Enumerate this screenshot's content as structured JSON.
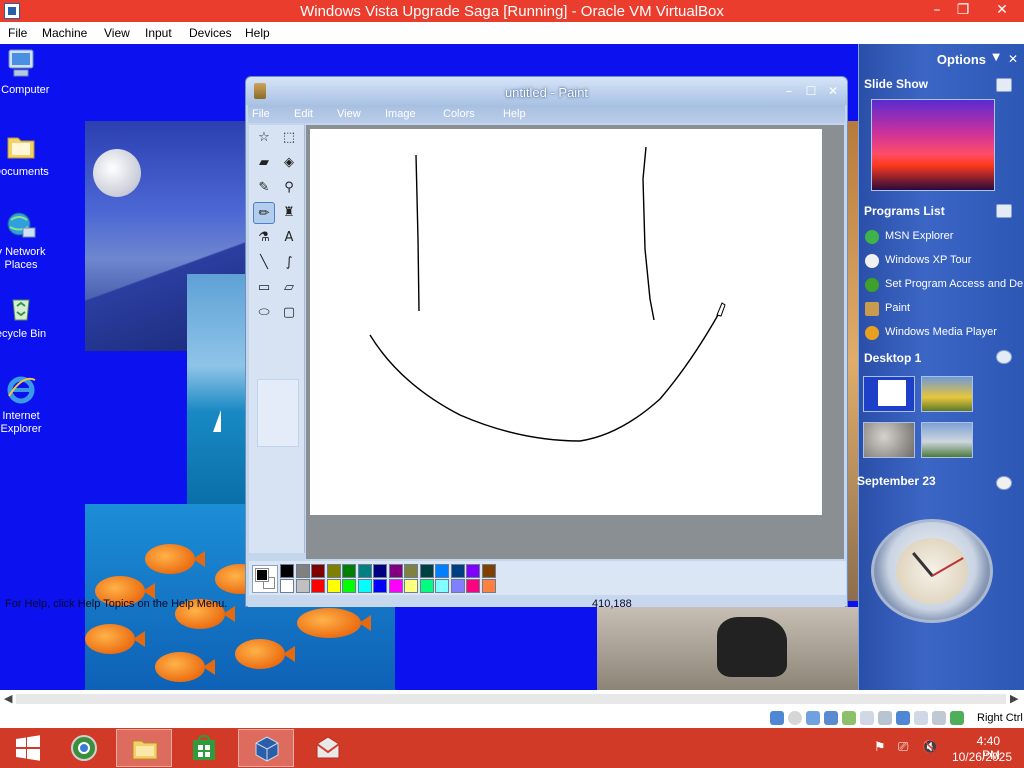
{
  "host": {
    "title": "Windows Vista Upgrade Saga [Running] - Oracle VM VirtualBox",
    "menu": [
      "File",
      "Machine",
      "View",
      "Input",
      "Devices",
      "Help"
    ],
    "controls": {
      "minimize": "–",
      "restore": "❐",
      "close": "✕"
    }
  },
  "desktop": {
    "icons": [
      {
        "label": "y Computer"
      },
      {
        "label": "Documents"
      },
      {
        "label": "y Network Places"
      },
      {
        "label": "ecycle Bin"
      },
      {
        "label": "Internet Explorer"
      }
    ]
  },
  "paint": {
    "title": "untitled - Paint",
    "controls": {
      "minimize": "–",
      "maximize": "☐",
      "close": "✕"
    },
    "menu": [
      "File",
      "Edit",
      "View",
      "Image",
      "Colors",
      "Help"
    ],
    "tools": [
      {
        "name": "free-select-icon",
        "glyph": "☆"
      },
      {
        "name": "rect-select-icon",
        "glyph": "⬚"
      },
      {
        "name": "eraser-icon",
        "glyph": "▰"
      },
      {
        "name": "fill-icon",
        "glyph": "◈"
      },
      {
        "name": "color-picker-icon",
        "glyph": "✎"
      },
      {
        "name": "magnifier-icon",
        "glyph": "⚲"
      },
      {
        "name": "pencil-icon",
        "glyph": "✏"
      },
      {
        "name": "brush-icon",
        "glyph": "♜"
      },
      {
        "name": "airbrush-icon",
        "glyph": "⚗"
      },
      {
        "name": "text-icon",
        "glyph": "A"
      },
      {
        "name": "line-icon",
        "glyph": "╲"
      },
      {
        "name": "curve-icon",
        "glyph": "∫"
      },
      {
        "name": "rectangle-icon",
        "glyph": "▭"
      },
      {
        "name": "polygon-icon",
        "glyph": "⏥"
      },
      {
        "name": "ellipse-icon",
        "glyph": "⬭"
      },
      {
        "name": "rounded-rect-icon",
        "glyph": "▢"
      }
    ],
    "selected_tool": "pencil-icon",
    "palette_top": [
      "#000000",
      "#808080",
      "#800000",
      "#808000",
      "#008000",
      "#008080",
      "#000080",
      "#800080",
      "#808040",
      "#004040",
      "#0080ff",
      "#004080",
      "#8000ff",
      "#804000"
    ],
    "palette_bottom": [
      "#ffffff",
      "#c0c0c0",
      "#ff0000",
      "#ffff00",
      "#00ff00",
      "#00ffff",
      "#0000ff",
      "#ff00ff",
      "#ffff80",
      "#00ff80",
      "#80ffff",
      "#8080ff",
      "#ff0080",
      "#ff8040"
    ],
    "foreground": "#000000",
    "background": "#ffffff",
    "status_help": "For Help, click Help Topics on the Help Menu.",
    "status_coords": "410,188"
  },
  "sidebar": {
    "options_label": "Options",
    "slideshow_title": "Slide Show",
    "programs_title": "Programs List",
    "programs": [
      {
        "label": "MSN Explorer",
        "color": "#3fb24a"
      },
      {
        "label": "Windows XP Tour",
        "color": "#f0f0f0"
      },
      {
        "label": "Set Program Access and Defaults",
        "color": "#3fa02c"
      },
      {
        "label": "Paint",
        "color": "#c99b4e"
      },
      {
        "label": "Windows Media Player",
        "color": "#e8a020"
      }
    ],
    "desktop_title": "Desktop 1",
    "date_title": "September 23"
  },
  "vbox_status": {
    "hostkey": "Right Ctrl"
  },
  "taskbar": {
    "time": "4:40 PM",
    "date": "10/26/2025"
  }
}
